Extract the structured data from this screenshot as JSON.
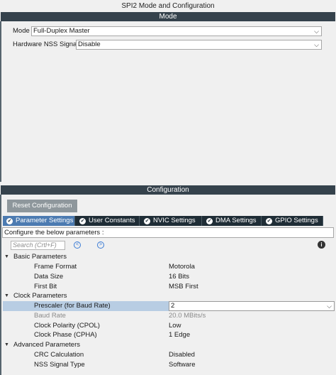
{
  "window": {
    "title": "SPI2 Mode and Configuration"
  },
  "mode": {
    "header": "Mode",
    "mode_label": "Mode",
    "mode_value": "Full-Duplex Master",
    "nss_label": "Hardware NSS Signal",
    "nss_value": "Disable"
  },
  "configuration": {
    "header": "Configuration",
    "reset_label": "Reset Configuration",
    "tabs": [
      {
        "label": "Parameter Settings",
        "active": true
      },
      {
        "label": "User Constants",
        "active": false
      },
      {
        "label": "NVIC Settings",
        "active": false
      },
      {
        "label": "DMA Settings",
        "active": false
      },
      {
        "label": "GPIO Settings",
        "active": false
      }
    ],
    "configure_text": "Configure the below parameters :",
    "search_placeholder": "Search (Crtl+F)",
    "groups": {
      "basic": {
        "name": "Basic Parameters",
        "rows": [
          {
            "name": "Frame Format",
            "value": "Motorola"
          },
          {
            "name": "Data Size",
            "value": "16 Bits"
          },
          {
            "name": "First Bit",
            "value": "MSB First"
          }
        ]
      },
      "clock": {
        "name": "Clock Parameters",
        "rows": [
          {
            "name": "Prescaler (for Baud Rate)",
            "value": "2"
          },
          {
            "name": "Baud Rate",
            "value": "20.0 MBits/s"
          },
          {
            "name": "Clock Polarity (CPOL)",
            "value": "Low"
          },
          {
            "name": "Clock Phase (CPHA)",
            "value": "1 Edge"
          }
        ]
      },
      "advanced": {
        "name": "Advanced Parameters",
        "rows": [
          {
            "name": "CRC Calculation",
            "value": "Disabled"
          },
          {
            "name": "NSS Signal Type",
            "value": "Software"
          }
        ]
      }
    }
  },
  "icons": {
    "check": "check-icon",
    "chevron": "chevron-down-icon",
    "info": "info-icon"
  },
  "colors": {
    "header_bg": "#35424c",
    "tab_bg": "#1f2d36",
    "tab_active": "#4c7bb1",
    "selected_row": "#b8cde3"
  }
}
